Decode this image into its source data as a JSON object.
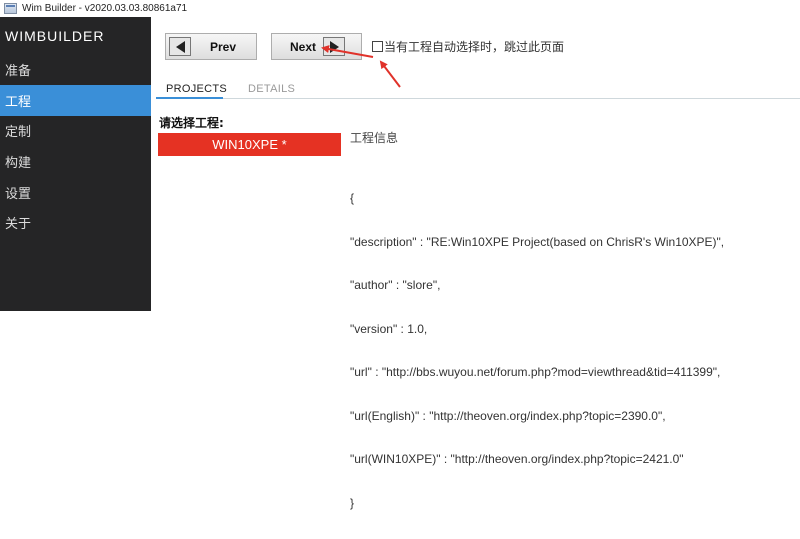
{
  "window": {
    "title": "Wim Builder - v2020.03.03.80861a71"
  },
  "sidebar": {
    "brand": "WIMBUILDER",
    "items": [
      {
        "label": "准备",
        "active": false
      },
      {
        "label": "工程",
        "active": true
      },
      {
        "label": "定制",
        "active": false
      },
      {
        "label": "构建",
        "active": false
      },
      {
        "label": "设置",
        "active": false
      },
      {
        "label": "关于",
        "active": false
      }
    ]
  },
  "toolbar": {
    "prev_label": "Prev",
    "next_label": "Next",
    "auto_skip_label": "当有工程自动选择时，跳过此页面",
    "auto_skip_checked": false
  },
  "tabs": [
    {
      "label": "PROJECTS",
      "active": true
    },
    {
      "label": "DETAILS",
      "active": false
    }
  ],
  "projects": {
    "select_label": "请选择工程:",
    "items": [
      "WIN10XPE *"
    ]
  },
  "info": {
    "title": "工程信息",
    "json_lines": [
      "{",
      "\"description\" : \"RE:Win10XPE Project(based on ChrisR's Win10XPE)\",",
      "\"author\" : \"slore\",",
      "\"version\" : 1.0,",
      "\"url\" : \"http://bbs.wuyou.net/forum.php?mod=viewthread&tid=411399\",",
      "\"url(English)\" : \"http://theoven.org/index.php?topic=2390.0\",",
      "\"url(WIN10XPE)\" : \"http://theoven.org/index.php?topic=2421.0\"",
      "}"
    ]
  },
  "colors": {
    "sidebar_bg": "#252526",
    "accent": "#3a8fd8",
    "project_selected": "#e53223",
    "annotation_arrow": "#e0322a"
  }
}
